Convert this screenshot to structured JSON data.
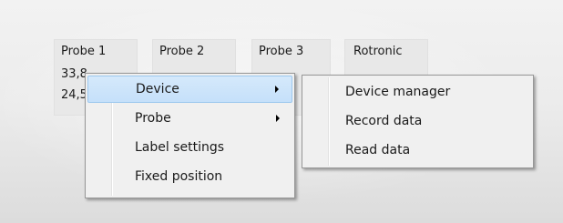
{
  "probes": [
    {
      "title": "Probe 1",
      "line1": "33,8",
      "line2": "24,5"
    },
    {
      "title": "Probe 2",
      "line1": "",
      "line2": ""
    },
    {
      "title": "Probe 3",
      "line1": "",
      "line2": ""
    },
    {
      "title": "Rotronic",
      "line1": "",
      "line2": ""
    }
  ],
  "context_menu": {
    "items": [
      {
        "label": "Device",
        "has_submenu": true,
        "highlighted": true
      },
      {
        "label": "Probe",
        "has_submenu": true,
        "highlighted": false
      },
      {
        "label": "Label settings",
        "has_submenu": false,
        "highlighted": false
      },
      {
        "label": "Fixed position",
        "has_submenu": false,
        "highlighted": false
      }
    ]
  },
  "device_submenu": {
    "items": [
      {
        "label": "Device manager"
      },
      {
        "label": "Record data"
      },
      {
        "label": "Read data"
      }
    ]
  },
  "colors": {
    "highlight_bg": "#cde4fa",
    "highlight_border": "#9cc7ee",
    "menu_bg": "#f0f0f0",
    "menu_border": "#979797"
  },
  "icons": {
    "submenu_arrow": "chevron-right-icon"
  }
}
